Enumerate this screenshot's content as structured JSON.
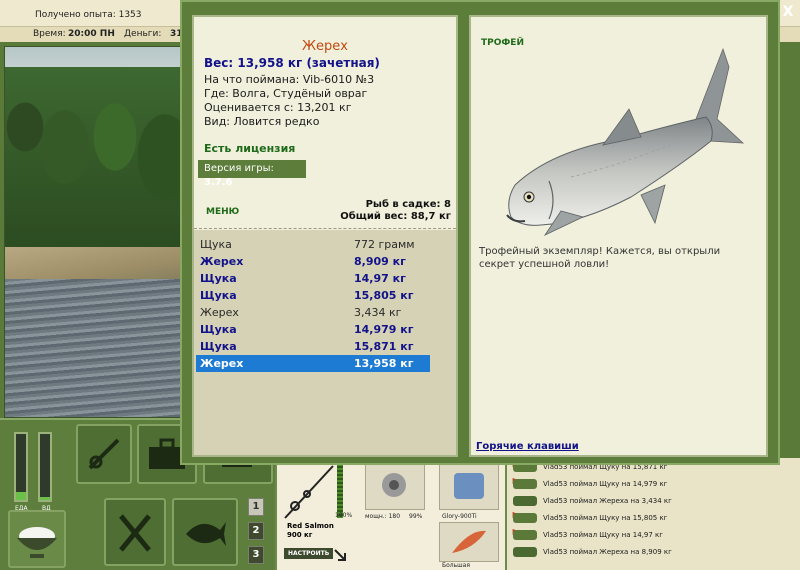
{
  "topbar": {
    "xp": "Получено опыта: 1353",
    "time_label": "Время:",
    "time_value": "20:00 ПН",
    "money_label": "Деньги:",
    "money_value": "31"
  },
  "dialog": {
    "close_label": "X",
    "fish_name": "Жерех",
    "weight_line": "Вес: 13,958 кг (зачетная)",
    "caught_on": "На что поймана: Vib-6010 №3",
    "where": "Где: Волга, Студёный овраг",
    "valued_at": "Оценивается с: 13,201 кг",
    "kind": "Вид: Ловится редко",
    "license": "Есть лицензия",
    "version_label": "Версия игры:",
    "version_value": "3.7.6",
    "menu_label": "МЕНЮ",
    "keep_count": "Рыб в садке: 8",
    "keep_weight": "Общий вес: 88,7 кг",
    "trophy_label": "ТРОФЕЙ",
    "description": "Трофейный экземпляр! Кажется, вы открыли секрет успешной ловли!",
    "hotkeys_label": "Горячие клавиши"
  },
  "catches": [
    {
      "name": "Щука",
      "weight": "772 грамм",
      "style": "normal"
    },
    {
      "name": "Жерех",
      "weight": "8,909 кг",
      "style": "trophy"
    },
    {
      "name": "Щука",
      "weight": "14,97 кг",
      "style": "trophy"
    },
    {
      "name": "Щука",
      "weight": "15,805 кг",
      "style": "trophy"
    },
    {
      "name": "Жерех",
      "weight": "3,434 кг",
      "style": "normal"
    },
    {
      "name": "Щука",
      "weight": "14,979 кг",
      "style": "trophy"
    },
    {
      "name": "Щука",
      "weight": "15,871 кг",
      "style": "trophy"
    },
    {
      "name": "Жерех",
      "weight": "13,958 кг",
      "style": "selected"
    }
  ],
  "dock": {
    "food_label": "ЕДА",
    "water_label": "ВД",
    "food_level": 0.12,
    "water_level": 0.05,
    "slots": [
      "1",
      "2",
      "3"
    ]
  },
  "gear": {
    "rod_name": "Red Salmon",
    "rod_weight": "900 кг",
    "setup_label": "НАСТРОИТЬ",
    "rod_pct": "100%",
    "reel_power": "мощн.: 180",
    "reel_pct": "99%",
    "line_name": "Glory-900Ti",
    "lure_name": "Большая"
  },
  "feed": [
    {
      "text": "Vlad53 поймал Щуку на 15,871 кг",
      "flag": true
    },
    {
      "text": "Vlad53 поймал Щуку на 14,979 кг",
      "flag": true
    },
    {
      "text": "Vlad53 поймал Жереха на 3,434 кг",
      "flag": false
    },
    {
      "text": "Vlad53 поймал Щуку на 15,805 кг",
      "flag": true
    },
    {
      "text": "Vlad53 поймал Щуку на 14,97 кг",
      "flag": true
    },
    {
      "text": "Vlad53 поймал Жереха на 8,909 кг",
      "flag": false
    }
  ],
  "colors": {
    "panel_green": "#5d7d3b",
    "trophy_blue": "#12128a",
    "title_orange": "#c04a0e",
    "selected_blue": "#1e7bd4"
  }
}
